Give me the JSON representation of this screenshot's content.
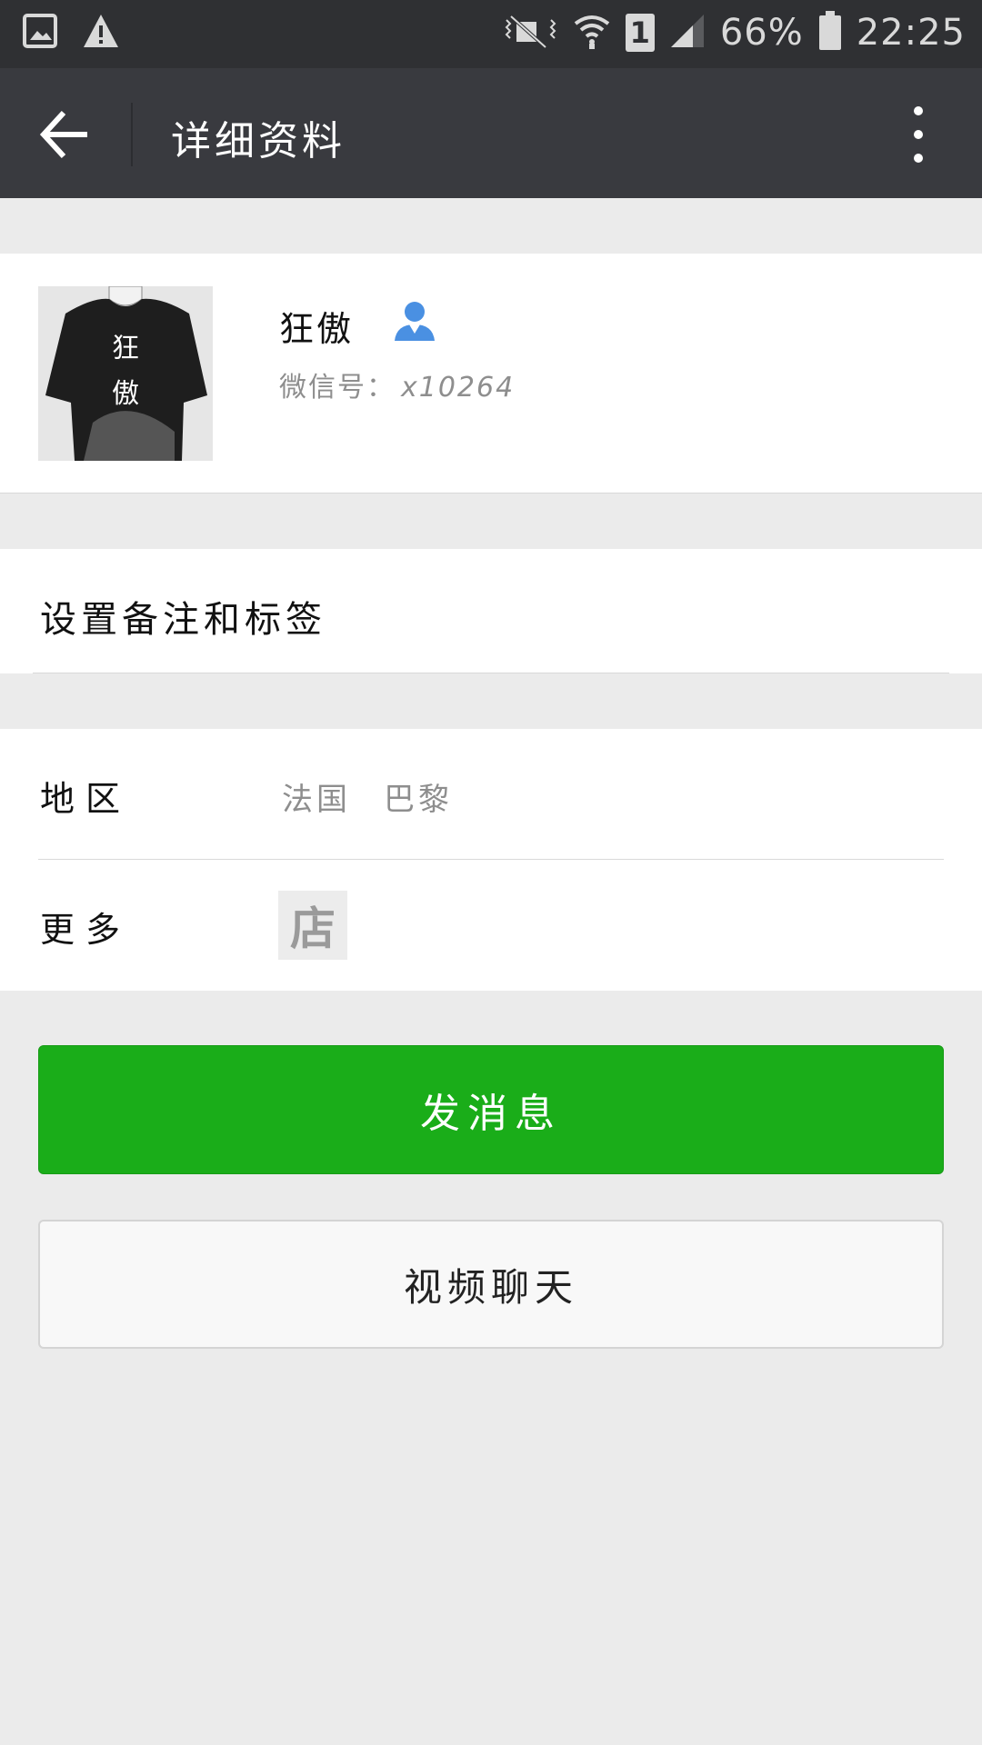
{
  "status_bar": {
    "battery": "66%",
    "time": "22:25",
    "sim": "1",
    "icons": [
      "gallery-icon",
      "warning-icon",
      "mute-icon",
      "wifi-icon",
      "sim-icon",
      "signal-icon",
      "battery-icon"
    ]
  },
  "app_bar": {
    "title": "详细资料",
    "back_icon": "back-arrow-icon",
    "more_icon": "more-vertical-icon"
  },
  "profile": {
    "name": "狂傲",
    "avatar_text_1": "狂",
    "avatar_text_2": "傲",
    "wechat_id_label": "微信号：",
    "wechat_id_value": "x10264",
    "contact_icon": "contact-person-icon",
    "contact_icon_color": "#4a90e2"
  },
  "remark": {
    "label": "设置备注和标签"
  },
  "info": {
    "region_label": "地区",
    "region_country": "法国",
    "region_city": "巴黎",
    "more_label": "更多",
    "store_icon_text": "店"
  },
  "actions": {
    "send_message": "发消息",
    "video_chat": "视频聊天"
  },
  "colors": {
    "primary_green": "#1aad19",
    "app_bar": "#393a3f",
    "status_bar": "#2f3033",
    "background": "#ebebeb"
  }
}
